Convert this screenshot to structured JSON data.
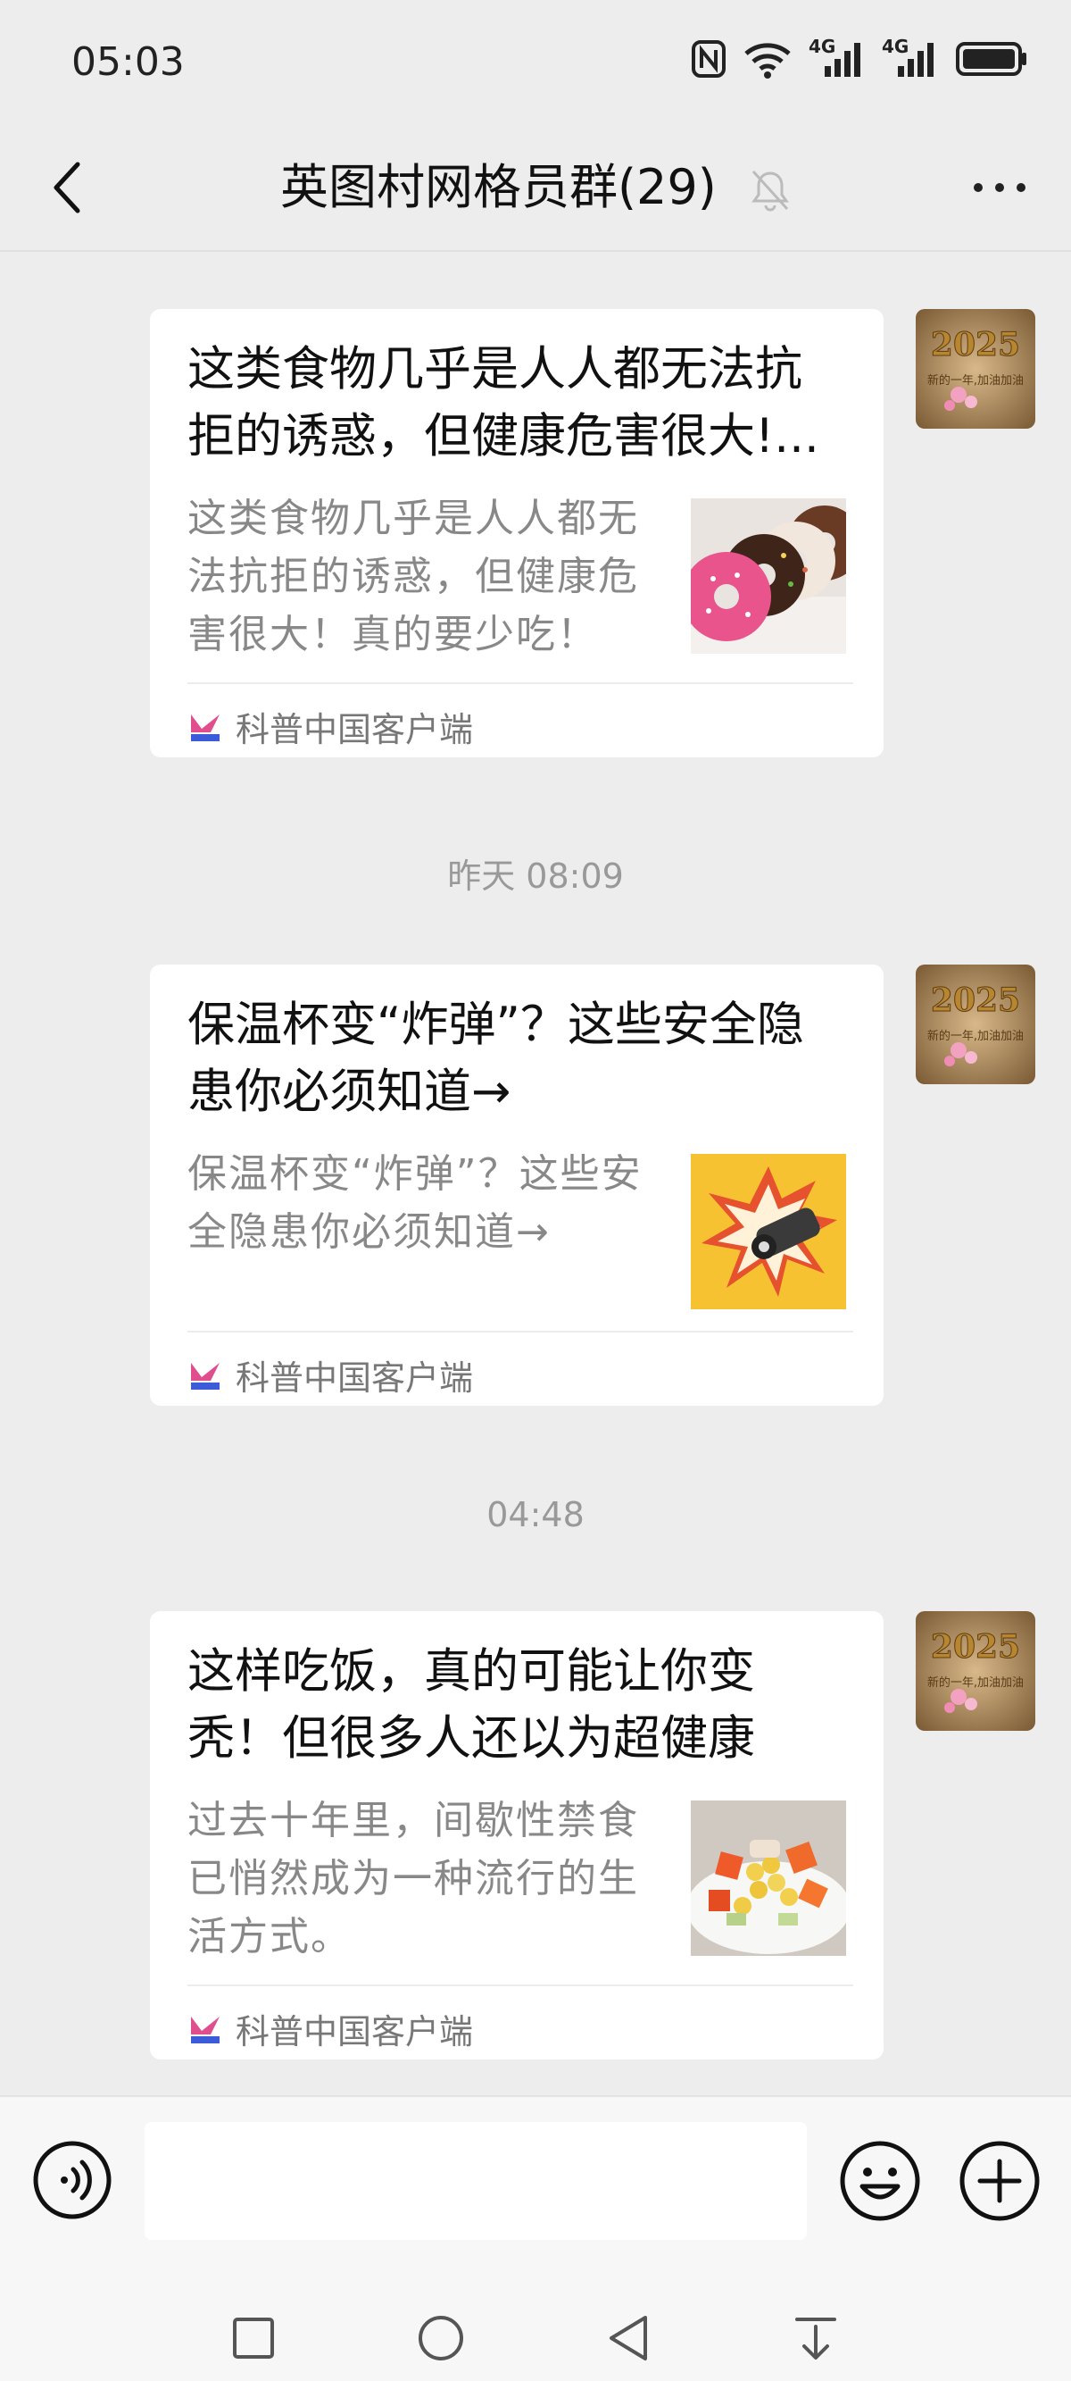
{
  "status_bar": {
    "time": "05:03",
    "net1": "4G",
    "net2": "4G"
  },
  "header": {
    "title": "英图村网格员群(29)"
  },
  "messages": [
    {
      "title": "这类食物几乎是人人都无法抗拒的诱惑，但健康危害很大!...",
      "desc": "这类食物几乎是人人都无法抗拒的诱惑，但健康危害很大！真的要少吃！",
      "source": "科普中国客户端",
      "thumb_icon": "donut-image"
    },
    {
      "title": "保温杯变“炸弹”？这些安全隐患你必须知道→",
      "desc": "保温杯变“炸弹”？这些安全隐患你必须知道→",
      "source": "科普中国客户端",
      "thumb_icon": "thermos-explosion-image"
    },
    {
      "title": "这样吃饭，真的可能让你变秃！但很多人还以为超健康",
      "desc": "过去十年里，间歇性禁食已悄然成为一种流行的生活方式。",
      "source": "科普中国客户端",
      "thumb_icon": "salad-image"
    }
  ],
  "timestamps": [
    "昨天 08:09",
    "04:48"
  ],
  "avatar": {
    "year": "2025",
    "caption": "新的一年,加油加油"
  },
  "colors": {
    "background": "#ededed",
    "card": "#ffffff",
    "muted": "#888888"
  }
}
